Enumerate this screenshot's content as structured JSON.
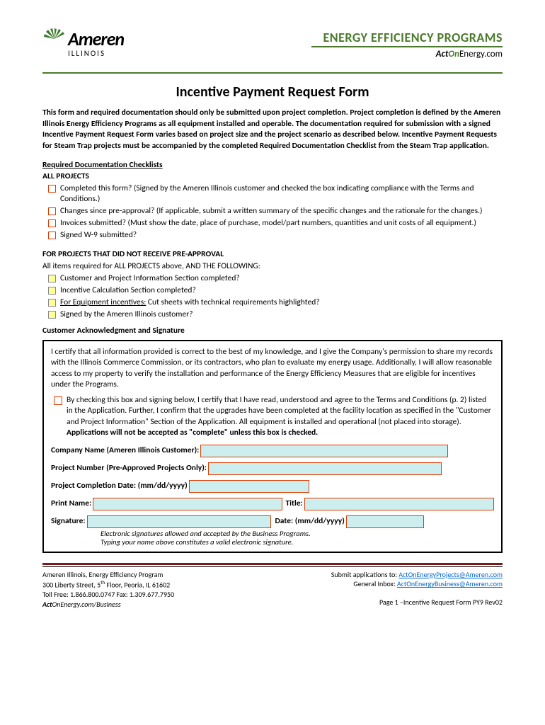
{
  "logo": {
    "name": "Ameren",
    "sub": "ILLINOIS"
  },
  "header": {
    "eep": "ENERGY EFFICIENCY PROGRAMS",
    "aoe_act": "Act",
    "aoe_on": "On",
    "aoe_rest": "Energy.com"
  },
  "title": "Incentive Payment Request Form",
  "intro": "This form and required documentation should only be submitted upon project completion.  Project completion is defined by the Ameren Illinois Energy Efficiency Programs as all equipment installed and operable.  The documentation required for submission with a signed Incentive Payment Request Form varies based on project size and the project scenario as described below.  Incentive Payment Requests for Steam Trap projects must be accompanied by the completed Required Documentation Checklist from the Steam Trap application.",
  "checklists_label": "Required Documentation Checklists",
  "all_projects_label": "ALL PROJECTS",
  "all_checks": [
    "Completed this form? (Signed by the Ameren Illinois customer and checked the box indicating compliance with the Terms and Conditions.)",
    "Changes since pre-approval? (If applicable, submit a written summary of the specific changes and the rationale for the changes.)",
    "Invoices submitted? (Must show the date, place of purchase, model/part numbers, quantities and unit costs of all equipment.)",
    "Signed W-9 submitted?"
  ],
  "no_pre_label": "FOR PROJECTS THAT DID NOT RECEIVE PRE-APPROVAL",
  "no_pre_note": "All items required for ALL PROJECTS above, AND THE FOLLOWING:",
  "no_pre_checks": [
    "Customer and Project Information Section completed?",
    "Incentive Calculation Section completed?",
    "",
    "Signed by the Ameren Illinois customer?"
  ],
  "no_pre_check3_u": "For Equipment incentives:",
  "no_pre_check3_rest": " Cut sheets with technical requirements highlighted?",
  "ack_head": "Customer Acknowledgment and Signature",
  "ack_p1": "I certify that all information provided is correct to the best of my knowledge, and I give the Company's permission to share my records with the Illinois Commerce Commission, or its contractors, who plan to evaluate my energy usage. Additionally, I will allow reasonable access to my property to verify the installation and performance of the Energy Efficiency Measures that are eligible for incentives under the Programs.",
  "ack_p2a": "By checking this box and signing below, I certify that I have read, understood and agree to the Terms and Conditions (p. 2) listed in the Application.  Further, I confirm that the upgrades have been completed at the facility location as specified in the \"Customer and Project Information\" Section of the Application. All equipment is installed and operational (not placed into storage).  ",
  "ack_p2b": "Applications will not be accepted as \"complete\" unless this box is checked.",
  "fields": {
    "company": "Company Name (Ameren Illinois Customer):",
    "project_num": "Project Number (Pre-Approved Projects Only):",
    "completion": "Project Completion Date: (mm/dd/yyyy)",
    "print_name": "Print Name:",
    "title": "Title:",
    "signature": "Signature:",
    "date": "Date: (mm/dd/yyyy)"
  },
  "sig_note1": "Electronic signatures allowed and accepted by the Business Programs.",
  "sig_note2": "Typing your name above constitutes a valid electronic signature.",
  "footer": {
    "l1": "Ameren Illinois, Energy Efficiency Program",
    "l2a": "300 Liberty Street, 5",
    "l2b": " Floor, Peoria, IL 61602",
    "l3": "Toll Free: 1.866.800.0747     Fax: 1.309.677.7950",
    "l4a": "Act",
    "l4b": "On",
    "l4c": "Energy.com/Business",
    "r1a": "Submit applications to: ",
    "r1b": "ActOnEnergyProjects@Ameren.com",
    "r2a": "General Inbox: ",
    "r2b": "ActOnEnergyBusiness@Ameren.com",
    "r3": "Page 1 –Incentive Request Form PY9 Rev02"
  }
}
